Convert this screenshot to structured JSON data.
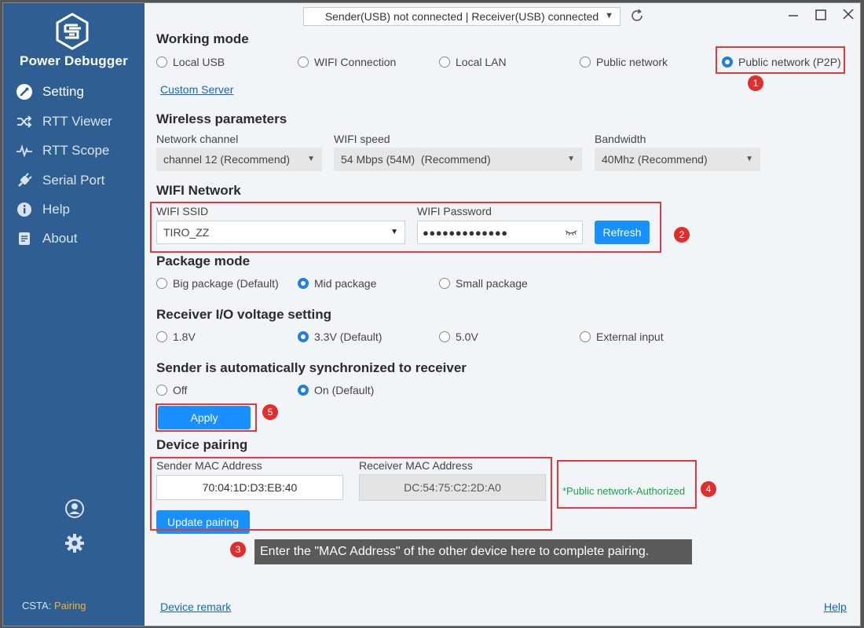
{
  "sidebar": {
    "brand": "Power Debugger",
    "items": [
      {
        "label": "Setting",
        "icon": "wrench-icon"
      },
      {
        "label": "RTT Viewer",
        "icon": "shuffle-icon"
      },
      {
        "label": "RTT Scope",
        "icon": "waveform-icon"
      },
      {
        "label": "Serial Port",
        "icon": "plug-icon"
      },
      {
        "label": "Help",
        "icon": "info-icon"
      },
      {
        "label": "About",
        "icon": "document-icon"
      }
    ],
    "csta_label": "CSTA:",
    "csta_value": "Pairing"
  },
  "topbar": {
    "connection_status": "Sender(USB) not connected | Receiver(USB) connected"
  },
  "working_mode": {
    "title": "Working mode",
    "options": [
      "Local USB",
      "WIFI Connection",
      "Local LAN",
      "Public network",
      "Public network (P2P)"
    ],
    "selected": "Public network (P2P)",
    "custom_server_link": "Custom Server"
  },
  "wireless": {
    "title": "Wireless parameters",
    "channel_label": "Network channel",
    "channel_value": "channel 12 (Recommend)",
    "speed_label": "WIFI speed",
    "speed_value": "54 Mbps (54M)  (Recommend)",
    "bandwidth_label": "Bandwidth",
    "bandwidth_value": "40Mhz (Recommend)"
  },
  "wifi": {
    "title": "WIFI Network",
    "ssid_label": "WIFI SSID",
    "ssid_value": "TIRO_ZZ",
    "password_label": "WIFI Password",
    "password_value": "●●●●●●●●●●●●●",
    "refresh_label": "Refresh"
  },
  "package": {
    "title": "Package mode",
    "options": [
      "Big package (Default)",
      "Mid package",
      "Small package"
    ],
    "selected": "Mid package"
  },
  "voltage": {
    "title": "Receiver I/O voltage setting",
    "options": [
      "1.8V",
      "3.3V (Default)",
      "5.0V",
      "External input"
    ],
    "selected": "3.3V (Default)"
  },
  "sync": {
    "title": "Sender is automatically synchronized to receiver",
    "options": [
      "Off",
      "On (Default)"
    ],
    "selected": "On (Default)",
    "apply_label": "Apply"
  },
  "pairing": {
    "title": "Device pairing",
    "sender_label": "Sender MAC Address",
    "sender_value": "70:04:1D:D3:EB:40",
    "receiver_label": "Receiver MAC Address",
    "receiver_value": "DC:54:75:C2:2D:A0",
    "update_label": "Update pairing",
    "auth_status": "*Public network-Authorized"
  },
  "annotations": {
    "badges": [
      "1",
      "2",
      "3",
      "4",
      "5"
    ],
    "tooltip": "Enter the \"MAC Address\" of the other device here to complete pairing."
  },
  "footer": {
    "device_remark": "Device remark",
    "help": "Help"
  },
  "colors": {
    "sidebar": "#2f5f92",
    "accent": "#1890ff",
    "annotation": "#e23a3a",
    "authorized": "#1aa34a",
    "csta_value": "#f0b233"
  }
}
